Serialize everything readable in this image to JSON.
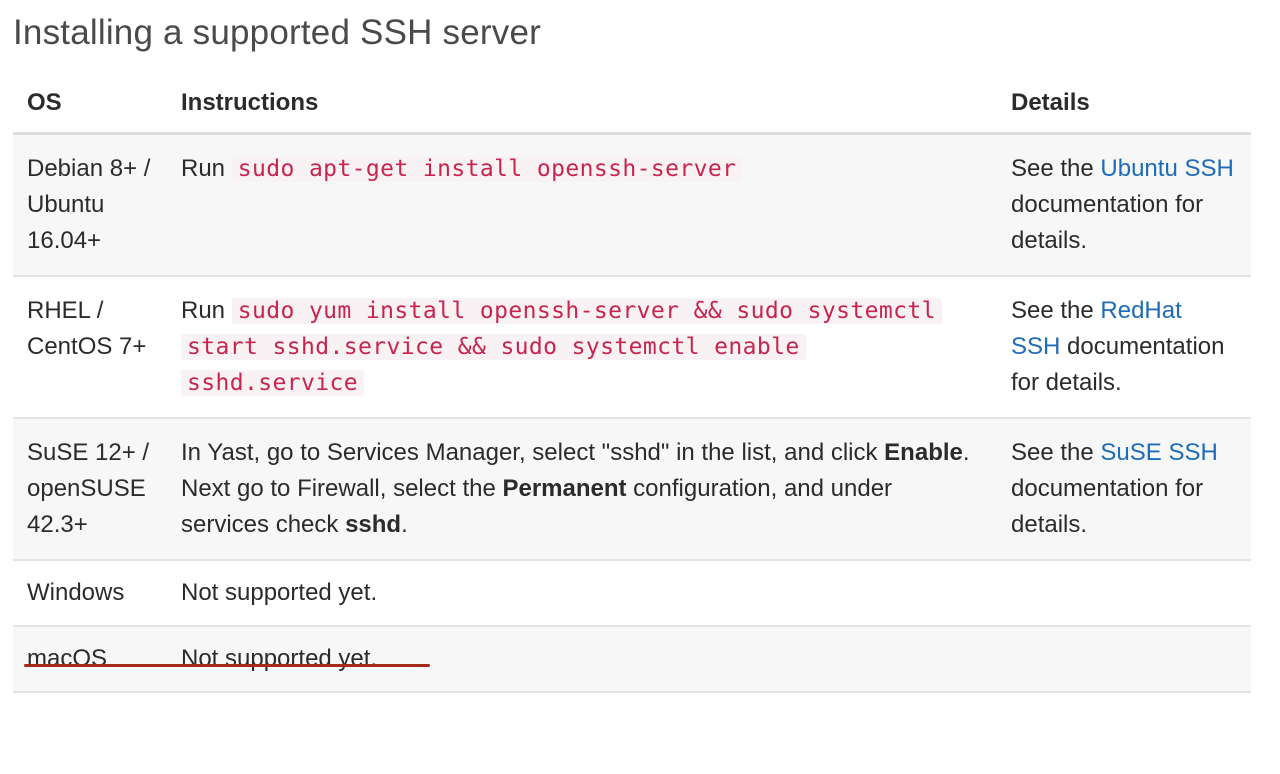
{
  "title": "Installing a supported SSH server",
  "headers": {
    "os": "OS",
    "instructions": "Instructions",
    "details": "Details"
  },
  "rows": [
    {
      "os": "Debian 8+ / Ubuntu 16.04+",
      "instructions_prefix": "Run ",
      "command": "sudo apt-get install openssh-server",
      "details_prefix": "See the ",
      "details_link": "Ubuntu SSH",
      "details_suffix": " documentation for details."
    },
    {
      "os": "RHEL / CentOS 7+",
      "instructions_prefix": "Run ",
      "command": "sudo yum install openssh-server && sudo systemctl start sshd.service && sudo systemctl enable sshd.service",
      "details_prefix": "See the ",
      "details_link": "RedHat SSH",
      "details_suffix": " documentation for details."
    },
    {
      "os": "SuSE 12+ / openSUSE 42.3+",
      "ins_part1": "In Yast, go to Services Manager, select \"sshd\" in the list, and click ",
      "ins_bold1": "Enable",
      "ins_part2": ". Next go to Firewall, select the ",
      "ins_bold2": "Permanent",
      "ins_part3": " configuration, and under services check ",
      "ins_bold3": "sshd",
      "ins_part4": ".",
      "details_prefix": "See the ",
      "details_link": "SuSE SSH",
      "details_suffix": " documentation for details."
    },
    {
      "os": "Windows",
      "instructions": "Not supported yet.",
      "details": ""
    },
    {
      "os": "macOS",
      "instructions": "Not supported yet.",
      "details": ""
    }
  ],
  "colors": {
    "code_text": "#c7254e",
    "code_bg": "#f9f2f4",
    "link": "#1e6bb8",
    "annotation_underline": "#a52a1a"
  }
}
